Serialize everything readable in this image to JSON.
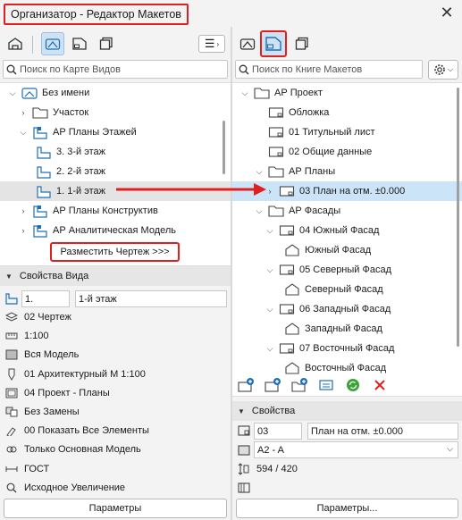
{
  "window": {
    "title": "Организатор - Редактор Макетов"
  },
  "left": {
    "search_placeholder": "Поиск по Карте Видов",
    "tree": [
      {
        "label": "Без имени"
      },
      {
        "label": "Участок"
      },
      {
        "label": "АР Планы Этажей"
      },
      {
        "label": "3. 3-й этаж"
      },
      {
        "label": "2. 2-й этаж"
      },
      {
        "label": "1. 1-й этаж"
      },
      {
        "label": "АР Планы Конструктив"
      },
      {
        "label": "АР Аналитическая Модель"
      }
    ],
    "place_button": "Разместить Чертеж >>>",
    "props_header": "Свойства Вида",
    "id_value": "1.",
    "name_value": "1-й этаж",
    "props": [
      {
        "label": "02 Чертеж",
        "icon": "layer-combination-icon"
      },
      {
        "label": "1:100",
        "icon": "scale-icon"
      },
      {
        "label": "Вся Модель",
        "icon": "structure-display-icon"
      },
      {
        "label": "01 Архитектурный М 1:100",
        "icon": "pen-set-icon"
      },
      {
        "label": "04 Проект - Планы",
        "icon": "model-view-options-icon"
      },
      {
        "label": "Без Замены",
        "icon": "graphic-override-icon"
      },
      {
        "label": "00 Показать Все Элементы",
        "icon": "renovation-filter-icon"
      },
      {
        "label": "Только Основная Модель",
        "icon": "hotlink-display-icon"
      },
      {
        "label": "ГОСТ",
        "icon": "dimension-standard-icon"
      },
      {
        "label": "Исходное Увеличение",
        "icon": "zoom-icon"
      }
    ],
    "params_button": "Параметры"
  },
  "right": {
    "search_placeholder": "Поиск по Книге Макетов",
    "tree": [
      {
        "label": "АР Проект"
      },
      {
        "label": "Обложка"
      },
      {
        "label": "01 Титульный лист"
      },
      {
        "label": "02 Общие данные"
      },
      {
        "label": "АР Планы"
      },
      {
        "label": "03 План на отм. ±0.000"
      },
      {
        "label": "АР Фасады"
      },
      {
        "label": "04 Южный Фасад"
      },
      {
        "label": "Южный Фасад"
      },
      {
        "label": "05 Северный Фасад"
      },
      {
        "label": "Северный Фасад"
      },
      {
        "label": "06 Западный Фасад"
      },
      {
        "label": "Западный Фасад"
      },
      {
        "label": "07 Восточный Фасад"
      },
      {
        "label": "Восточный Фасад"
      }
    ],
    "props_header": "Свойства",
    "id_value": "03",
    "name_value": "План на отм. ±0.000",
    "size_value": "A2 - A",
    "dims_value": "594 / 420",
    "params_button": "Параметры..."
  },
  "colors": {
    "accent": "#e01f1f",
    "selection": "#cce4f7",
    "icon_blue": "#1f6fb8"
  }
}
